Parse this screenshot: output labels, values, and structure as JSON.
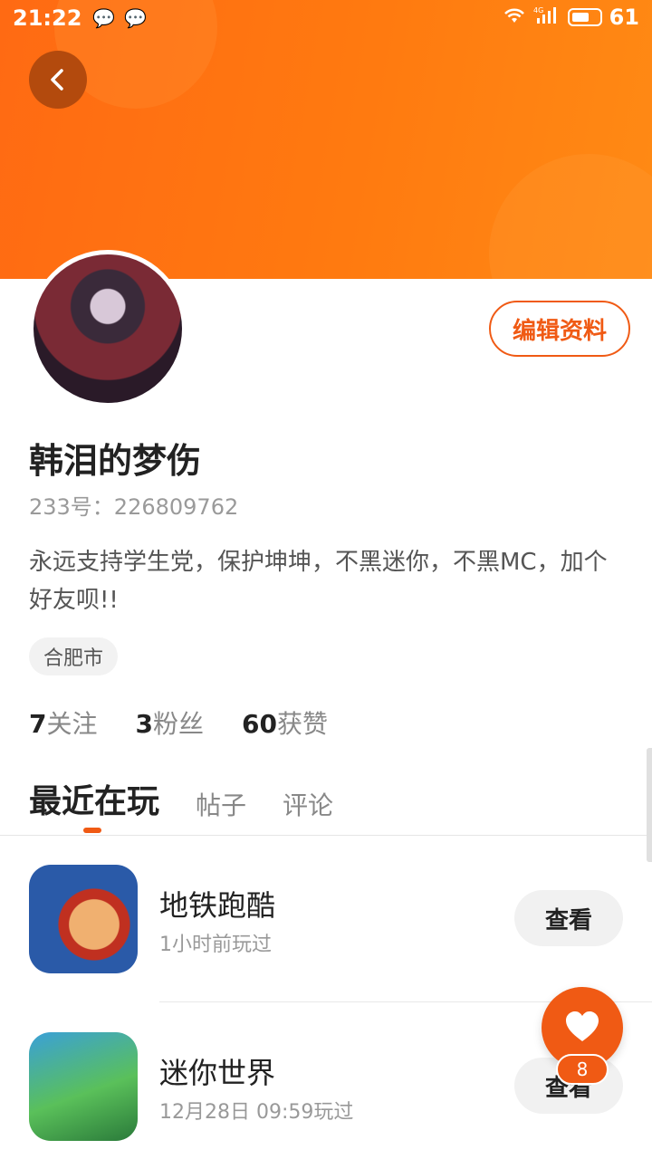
{
  "status": {
    "time": "21:22",
    "battery": "61",
    "network": "4G"
  },
  "profile": {
    "username": "韩泪的梦伤",
    "id_text": "233号：226809762",
    "bio": "永远支持学生党，保护坤坤，不黑迷你，不黑MC，加个好友呗!!",
    "location": "合肥市",
    "edit_label": "编辑资料"
  },
  "stats": [
    {
      "num": "7",
      "label": "关注"
    },
    {
      "num": "3",
      "label": "粉丝"
    },
    {
      "num": "60",
      "label": "获赞"
    }
  ],
  "tabs": [
    "最近在玩",
    "帖子",
    "评论"
  ],
  "games": [
    {
      "title": "地铁跑酷",
      "sub": "1小时前玩过",
      "action": "查看"
    },
    {
      "title": "迷你世界",
      "sub": "12月28日 09:59玩过",
      "action": "查看"
    }
  ],
  "fab": {
    "count": "8"
  },
  "colors": {
    "accent": "#f05a14",
    "banner": "#ff7410"
  }
}
